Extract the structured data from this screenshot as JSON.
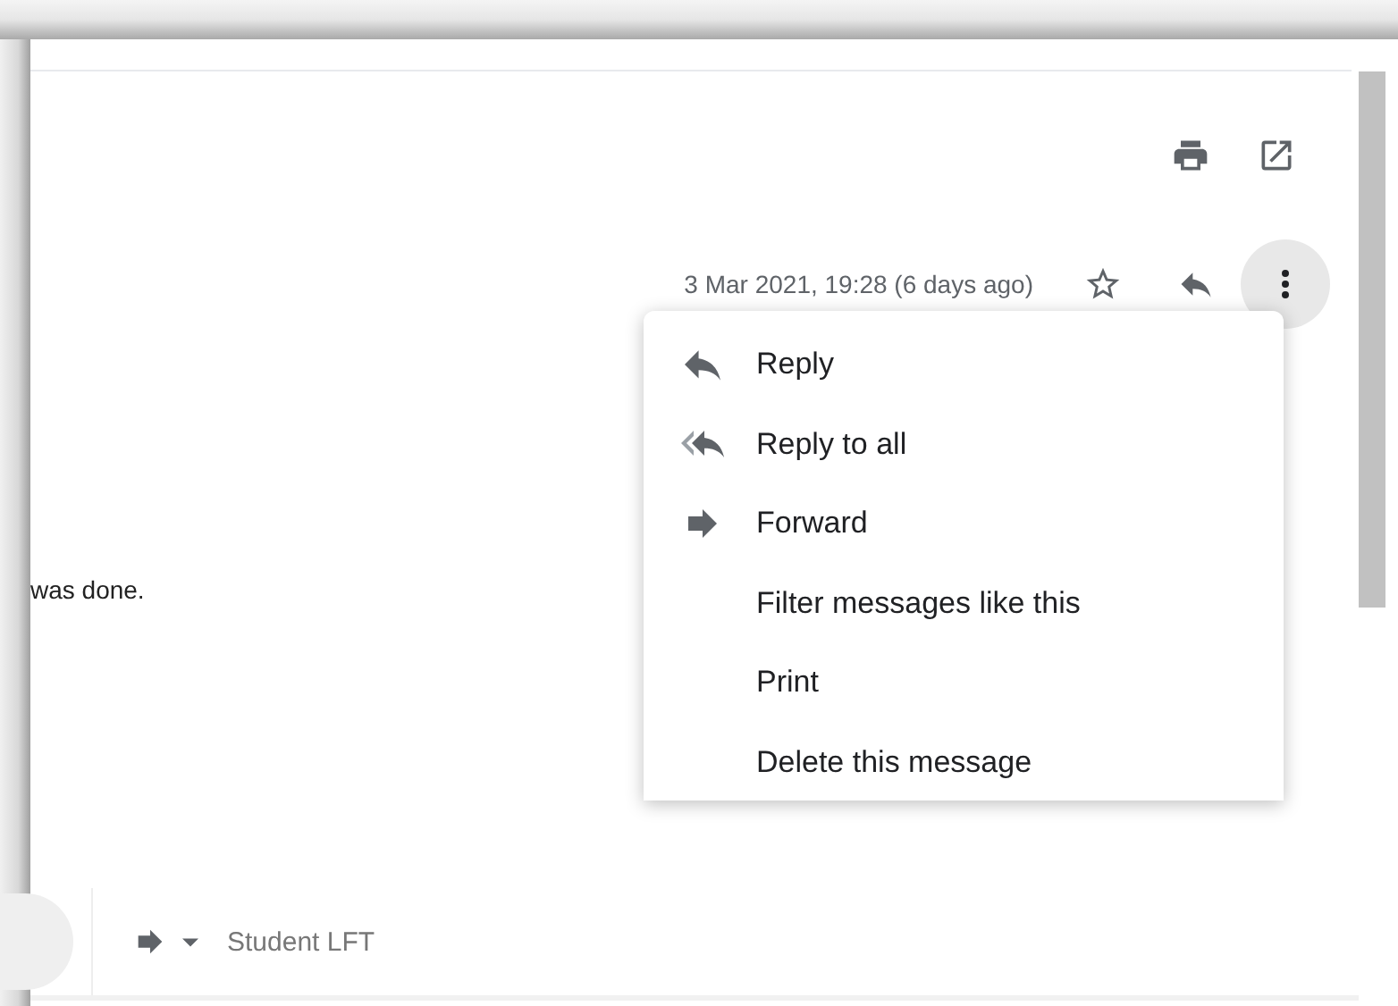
{
  "message": {
    "date": "3 Mar 2021, 19:28 (6 days ago)",
    "body_fragment": "was done."
  },
  "menu": {
    "items": [
      {
        "label": "Reply",
        "kind": "reply"
      },
      {
        "label": "Reply to all",
        "kind": "replyall"
      },
      {
        "label": "Forward",
        "kind": "forward"
      },
      {
        "label": "Filter messages like this",
        "kind": "plain"
      },
      {
        "label": "Print",
        "kind": "plain"
      },
      {
        "label": "Delete this message",
        "kind": "plain"
      }
    ]
  },
  "reply_bar": {
    "recipient": "Student LFT"
  }
}
